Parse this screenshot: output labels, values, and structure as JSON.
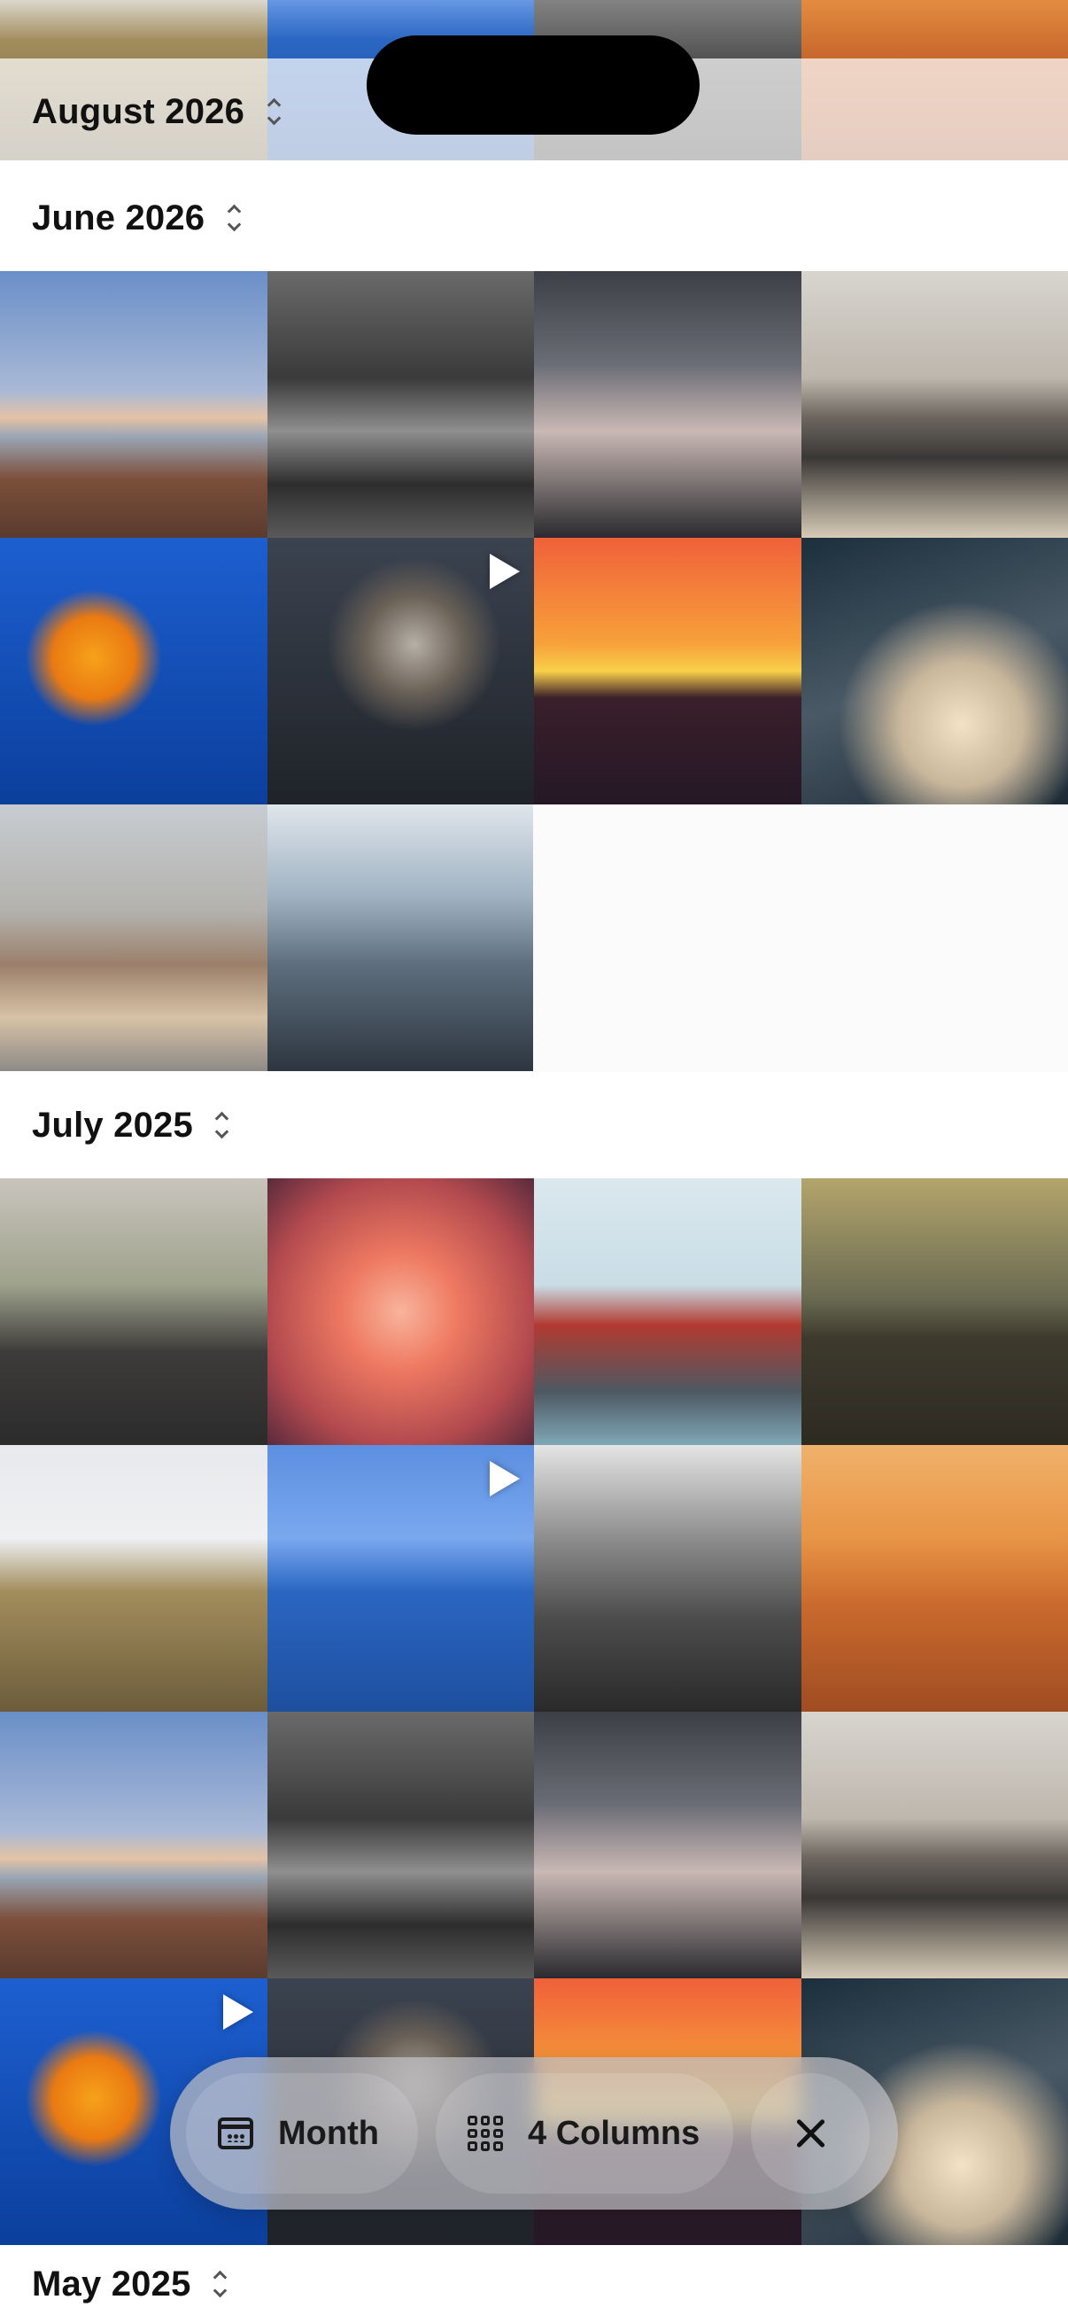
{
  "sections": [
    {
      "month": "August 2026"
    },
    {
      "month": "June 2026"
    },
    {
      "month": "July 2025"
    },
    {
      "month": "May 2025"
    }
  ],
  "tiles": [
    {
      "photo": "harbor-crane",
      "video": false
    },
    {
      "photo": "bridge-bw",
      "video": false
    },
    {
      "photo": "skyscraper",
      "video": false
    },
    {
      "photo": "laptop-desk",
      "video": false
    },
    {
      "photo": "jellyfish",
      "video": false
    },
    {
      "photo": "husky",
      "video": true
    },
    {
      "photo": "sunset-sea",
      "video": false
    },
    {
      "photo": "cross-clouds",
      "video": false
    },
    {
      "photo": "old-town",
      "video": false
    },
    {
      "photo": "city-fog",
      "video": false
    }
  ],
  "toolbar": {
    "month_label": "Month",
    "columns_label": "4 Columns",
    "month_icon": "calendar-icon",
    "columns_icon": "grid-icon",
    "close_icon": "close-icon"
  },
  "colors": {
    "header_text": "#111111",
    "toolbar_bg": "#bebec3",
    "background": "#ffffff"
  }
}
